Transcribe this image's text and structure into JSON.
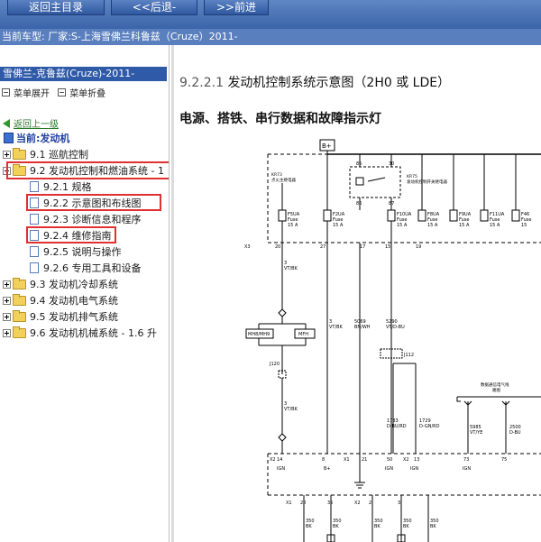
{
  "toolbar": {
    "home_label": "返回主目录",
    "back_label": "<<后退-",
    "forward_label": ">>前进"
  },
  "status": {
    "text": "当前车型:  厂家:S-上海雪佛兰科鲁兹（Cruze）2011-"
  },
  "tree": {
    "header": "雪佛兰-克鲁兹(Cruze)-2011-",
    "expand_label": "菜单展开",
    "collapse_label": "菜单折叠",
    "up_link": "返回上一级",
    "current": "当前:发动机",
    "items": [
      {
        "label": "9.1 巡航控制",
        "type": "folder",
        "expanded": false
      },
      {
        "label": "9.2 发动机控制和燃油系统 - 1",
        "type": "folder",
        "expanded": true
      },
      {
        "label": "9.2.1 规格",
        "type": "doc"
      },
      {
        "label": "9.2.2 示意图和布线图",
        "type": "doc"
      },
      {
        "label": "9.2.3 诊断信息和程序",
        "type": "doc"
      },
      {
        "label": "9.2.4 维修指南",
        "type": "doc"
      },
      {
        "label": "9.2.5 说明与操作",
        "type": "doc"
      },
      {
        "label": "9.2.6 专用工具和设备",
        "type": "doc"
      },
      {
        "label": "9.3 发动机冷却系统",
        "type": "folder",
        "expanded": false
      },
      {
        "label": "9.4 发动机电气系统",
        "type": "folder",
        "expanded": false
      },
      {
        "label": "9.5 发动机排气系统",
        "type": "folder",
        "expanded": false
      },
      {
        "label": "9.6 发动机机械系统 - 1.6 升",
        "type": "folder",
        "expanded": false
      }
    ]
  },
  "content": {
    "title_number": "9.2.2.1",
    "title_text": "发动机控制系统示意图（2H0 或 LDE）",
    "subtitle": "电源、搭铁、串行数据和故障指示灯"
  },
  "diagram": {
    "battery": "B+",
    "relay_pins": [
      "85",
      "30",
      "86",
      "87"
    ],
    "relay_label": [
      "KR75",
      "发动机控制开关继电器"
    ],
    "x3_label": "X3",
    "kef_label": [
      "KR73",
      "点火主继电器"
    ],
    "fuses": [
      {
        "name": "F5UA",
        "rating": "15 A"
      },
      {
        "name": "F2UA",
        "rating": "15 A"
      },
      {
        "name": "F10UA",
        "rating": "15 A"
      },
      {
        "name": "F8UA",
        "rating": "15 A"
      },
      {
        "name": "F9UA",
        "rating": "15 A"
      },
      {
        "name": "F11UA",
        "rating": "15 A"
      },
      {
        "name": "F46",
        "rating": "15"
      }
    ],
    "fuse_word": "Fuse",
    "pins_top": [
      "20",
      "27",
      "17",
      "15",
      "19"
    ],
    "wires": [
      {
        "id": "3",
        "color": "VT/BK"
      },
      {
        "id": "5069",
        "color": "BN/WH"
      },
      {
        "id": "5290",
        "color": "VT/D-BU"
      },
      {
        "id": "1733",
        "color": "D-BU/RD"
      },
      {
        "id": "1729",
        "color": "D-GN/RD"
      },
      {
        "id": "5985",
        "color": "VT/YE"
      },
      {
        "id": "2500",
        "color": "D-BU"
      }
    ],
    "mh_label": "MH8/MH9",
    "mfh_label": "MFH",
    "j120": "J120",
    "j112": "J112",
    "wire3b": {
      "id": "3",
      "color": "VT/BK"
    },
    "serial_label": [
      "数据通信电气线",
      "路图"
    ],
    "x2_label": "X2",
    "x1_label": "X1",
    "pins_mid": [
      "14",
      "8",
      "21",
      "50",
      "13",
      "73",
      "75"
    ],
    "ign": "IGN",
    "bplus": "B+",
    "pins_bottom": [
      "20",
      "35",
      "2",
      "3"
    ],
    "ground_wires": [
      {
        "id": "350",
        "color": "BK"
      },
      {
        "id": "350",
        "color": "BK"
      },
      {
        "id": "350",
        "color": "BK"
      },
      {
        "id": "350",
        "color": "BK"
      },
      {
        "id": "350",
        "color": "BK"
      }
    ]
  }
}
